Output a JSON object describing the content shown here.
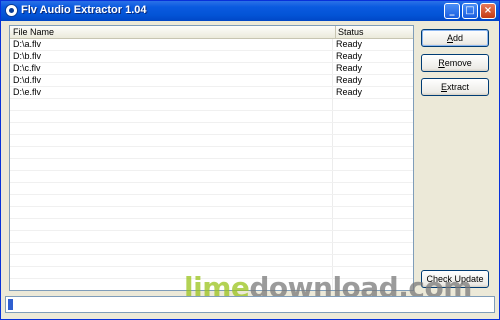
{
  "window": {
    "title": "Flv Audio Extractor 1.04",
    "controls": {
      "minimize_icon": "minimize-icon",
      "maximize_icon": "maximize-icon",
      "close_icon": "close-icon"
    }
  },
  "file_list": {
    "columns": {
      "name": "File Name",
      "status": "Status"
    },
    "rows": [
      {
        "name": "D:\\a.flv",
        "status": "Ready"
      },
      {
        "name": "D:\\b.flv",
        "status": "Ready"
      },
      {
        "name": "D:\\c.flv",
        "status": "Ready"
      },
      {
        "name": "D:\\d.flv",
        "status": "Ready"
      },
      {
        "name": "D:\\e.flv",
        "status": "Ready"
      }
    ]
  },
  "buttons": {
    "add": {
      "mnemonic": "A",
      "rest": "dd"
    },
    "remove": {
      "mnemonic": "R",
      "rest": "emove"
    },
    "extract": {
      "mnemonic": "E",
      "rest": "xtract"
    },
    "check_update": "Check Update"
  },
  "progress": {
    "value_fraction": 0.01
  },
  "watermark": {
    "part1": "lime",
    "part2": "download.com"
  },
  "colors": {
    "title_bar": "#0a5ae0",
    "progress_fill": "#2f5fd0",
    "watermark_green": "#9ac31c"
  }
}
